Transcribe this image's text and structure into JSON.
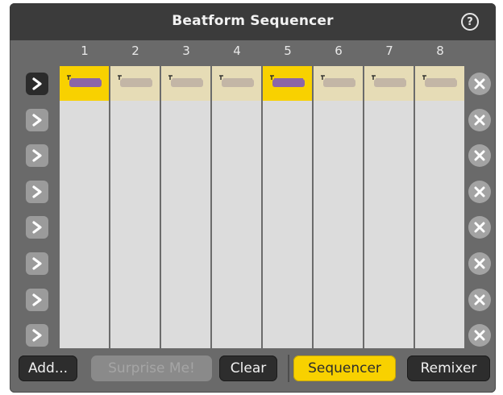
{
  "window": {
    "title": "Beatform Sequencer",
    "help_glyph": "?"
  },
  "columns": [
    "1",
    "2",
    "3",
    "4",
    "5",
    "6",
    "7",
    "8"
  ],
  "rows": 8,
  "active_row": 0,
  "active_steps_row1": [
    0,
    4
  ],
  "cell_icon": "bathtub-icon",
  "row_play_icon": "chevron-right-icon",
  "row_delete_icon": "close-icon",
  "toolbar": {
    "add_label": "Add...",
    "surprise_label": "Surprise Me!",
    "clear_label": "Clear",
    "sequencer_label": "Sequencer",
    "remixer_label": "Remixer"
  },
  "colors": {
    "accent": "#f8d100",
    "cell_inactive": "#e6dcb6",
    "cell_empty": "#dcdcdc",
    "icon_active": "#8b66a8",
    "icon_inactive": "#c3b6a6"
  }
}
